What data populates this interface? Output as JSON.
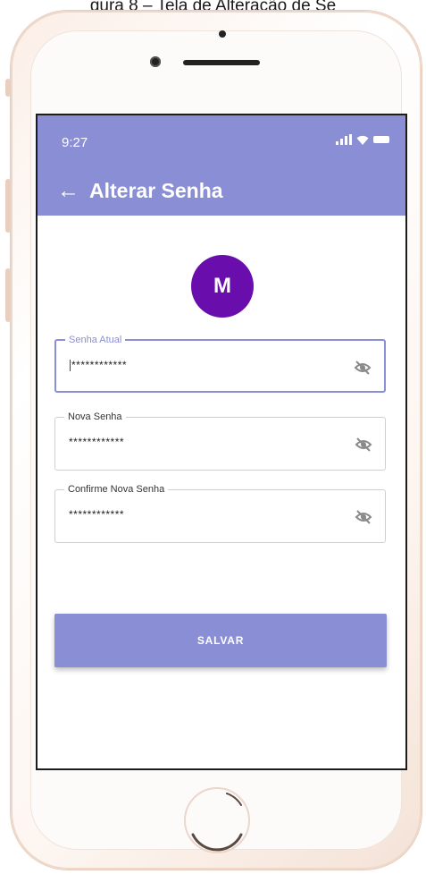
{
  "caption": "gura 8 – Tela de Alteração de Se",
  "status": {
    "time": "9:27"
  },
  "appbar": {
    "back_icon": "arrow-left-icon",
    "title": "Alterar Senha",
    "color": "#8A8ED4"
  },
  "avatar": {
    "initial": "M",
    "color": "#6A0DAD"
  },
  "form": {
    "fields": [
      {
        "label": "Senha Atual",
        "value": "************",
        "focused": true,
        "toggle_icon": "eye-off-icon"
      },
      {
        "label": "Nova Senha",
        "value": "************",
        "focused": false,
        "toggle_icon": "eye-off-icon"
      },
      {
        "label": "Confirme Nova Senha",
        "value": "************",
        "focused": false,
        "toggle_icon": "eye-off-icon"
      }
    ],
    "save_label": "SALVAR"
  }
}
